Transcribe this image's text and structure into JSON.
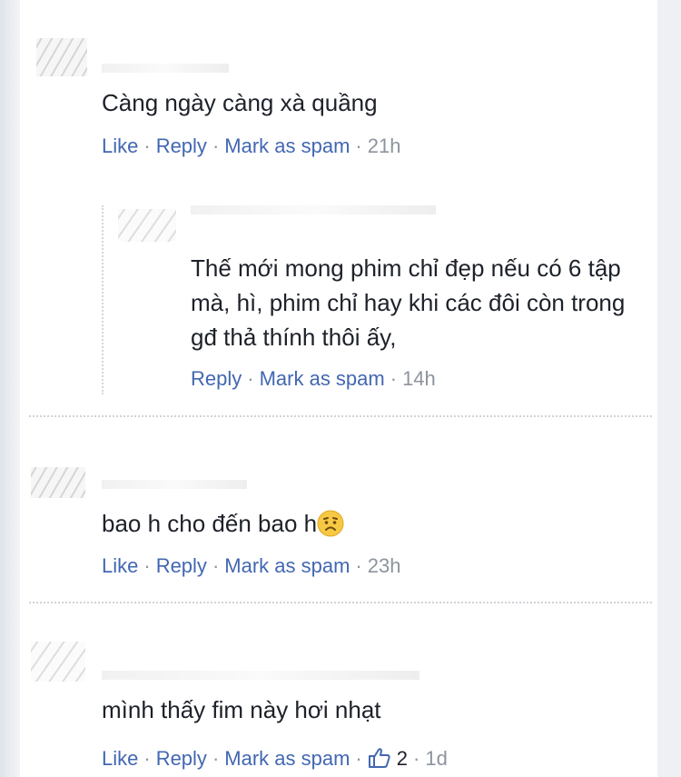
{
  "colors": {
    "link": "#4267b2",
    "meta": "#8d949e",
    "text": "#1d2129"
  },
  "comments": [
    {
      "text": "Càng ngày càng xà quầng",
      "actions": {
        "like": "Like",
        "reply": "Reply",
        "spam": "Mark as spam",
        "time": "21h"
      },
      "reply": {
        "text": "Thế mới mong phim chỉ đẹp nếu có 6 tập mà, hì, phim chỉ hay khi các đôi còn trong gđ thả thính thôi ấy,",
        "actions": {
          "reply": "Reply",
          "spam": "Mark as spam",
          "time": "14h"
        }
      }
    },
    {
      "text": "bao h cho đến bao h",
      "emoji": "worried-face-icon",
      "actions": {
        "like": "Like",
        "reply": "Reply",
        "spam": "Mark as spam",
        "time": "23h"
      }
    },
    {
      "text": "mình thấy fim này hơi nhạt",
      "actions": {
        "like": "Like",
        "reply": "Reply",
        "spam": "Mark as spam",
        "likes_icon": "thumbs-up-icon",
        "likes_count": "2",
        "time": "1d"
      }
    }
  ]
}
